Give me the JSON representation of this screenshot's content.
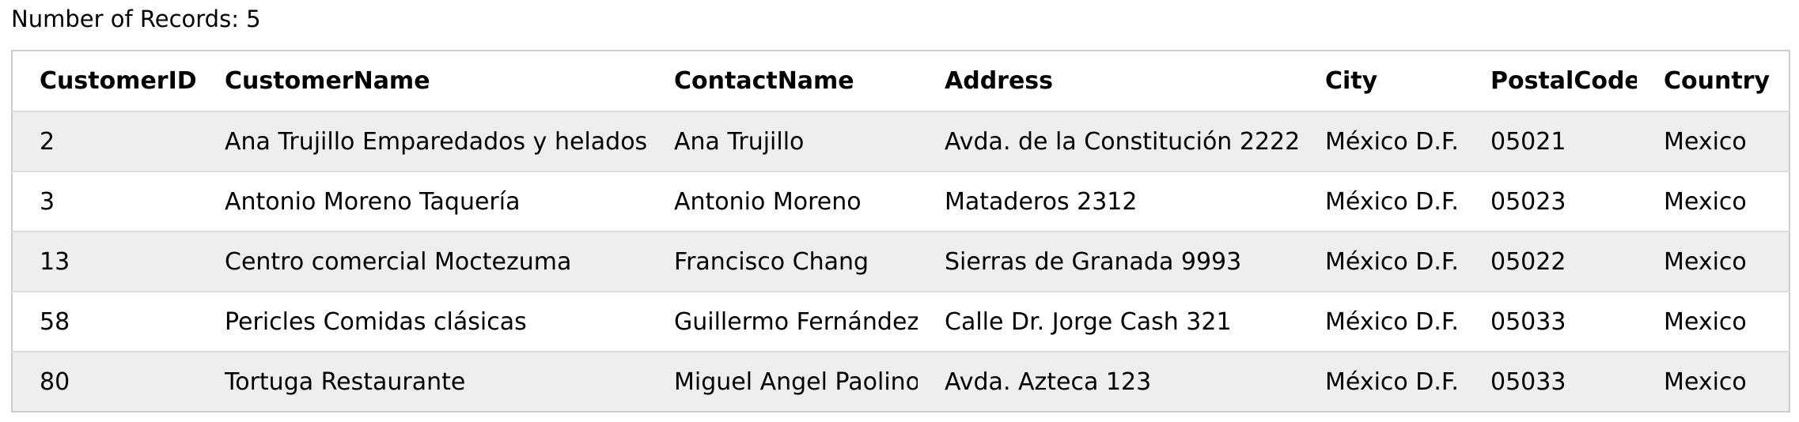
{
  "summary": {
    "record_count_text": "Number of Records: 5"
  },
  "table": {
    "headers": [
      "CustomerID",
      "CustomerName",
      "ContactName",
      "Address",
      "City",
      "PostalCode",
      "Country"
    ],
    "rows": [
      [
        "2",
        "Ana Trujillo Emparedados y helados",
        "Ana Trujillo",
        "Avda. de la Constitución 2222",
        "México D.F.",
        "05021",
        "Mexico"
      ],
      [
        "3",
        "Antonio Moreno Taquería",
        "Antonio Moreno",
        "Mataderos 2312",
        "México D.F.",
        "05023",
        "Mexico"
      ],
      [
        "13",
        "Centro comercial Moctezuma",
        "Francisco Chang",
        "Sierras de Granada 9993",
        "México D.F.",
        "05022",
        "Mexico"
      ],
      [
        "58",
        "Pericles Comidas clásicas",
        "Guillermo Fernández",
        "Calle Dr. Jorge Cash 321",
        "México D.F.",
        "05033",
        "Mexico"
      ],
      [
        "80",
        "Tortuga Restaurante",
        "Miguel Angel Paolino",
        "Avda. Azteca 123",
        "México D.F.",
        "05033",
        "Mexico"
      ]
    ]
  },
  "colors": {
    "odd_row_background": "#eeeeee",
    "even_row_background": "#ffffff",
    "border": "#cccccc"
  }
}
